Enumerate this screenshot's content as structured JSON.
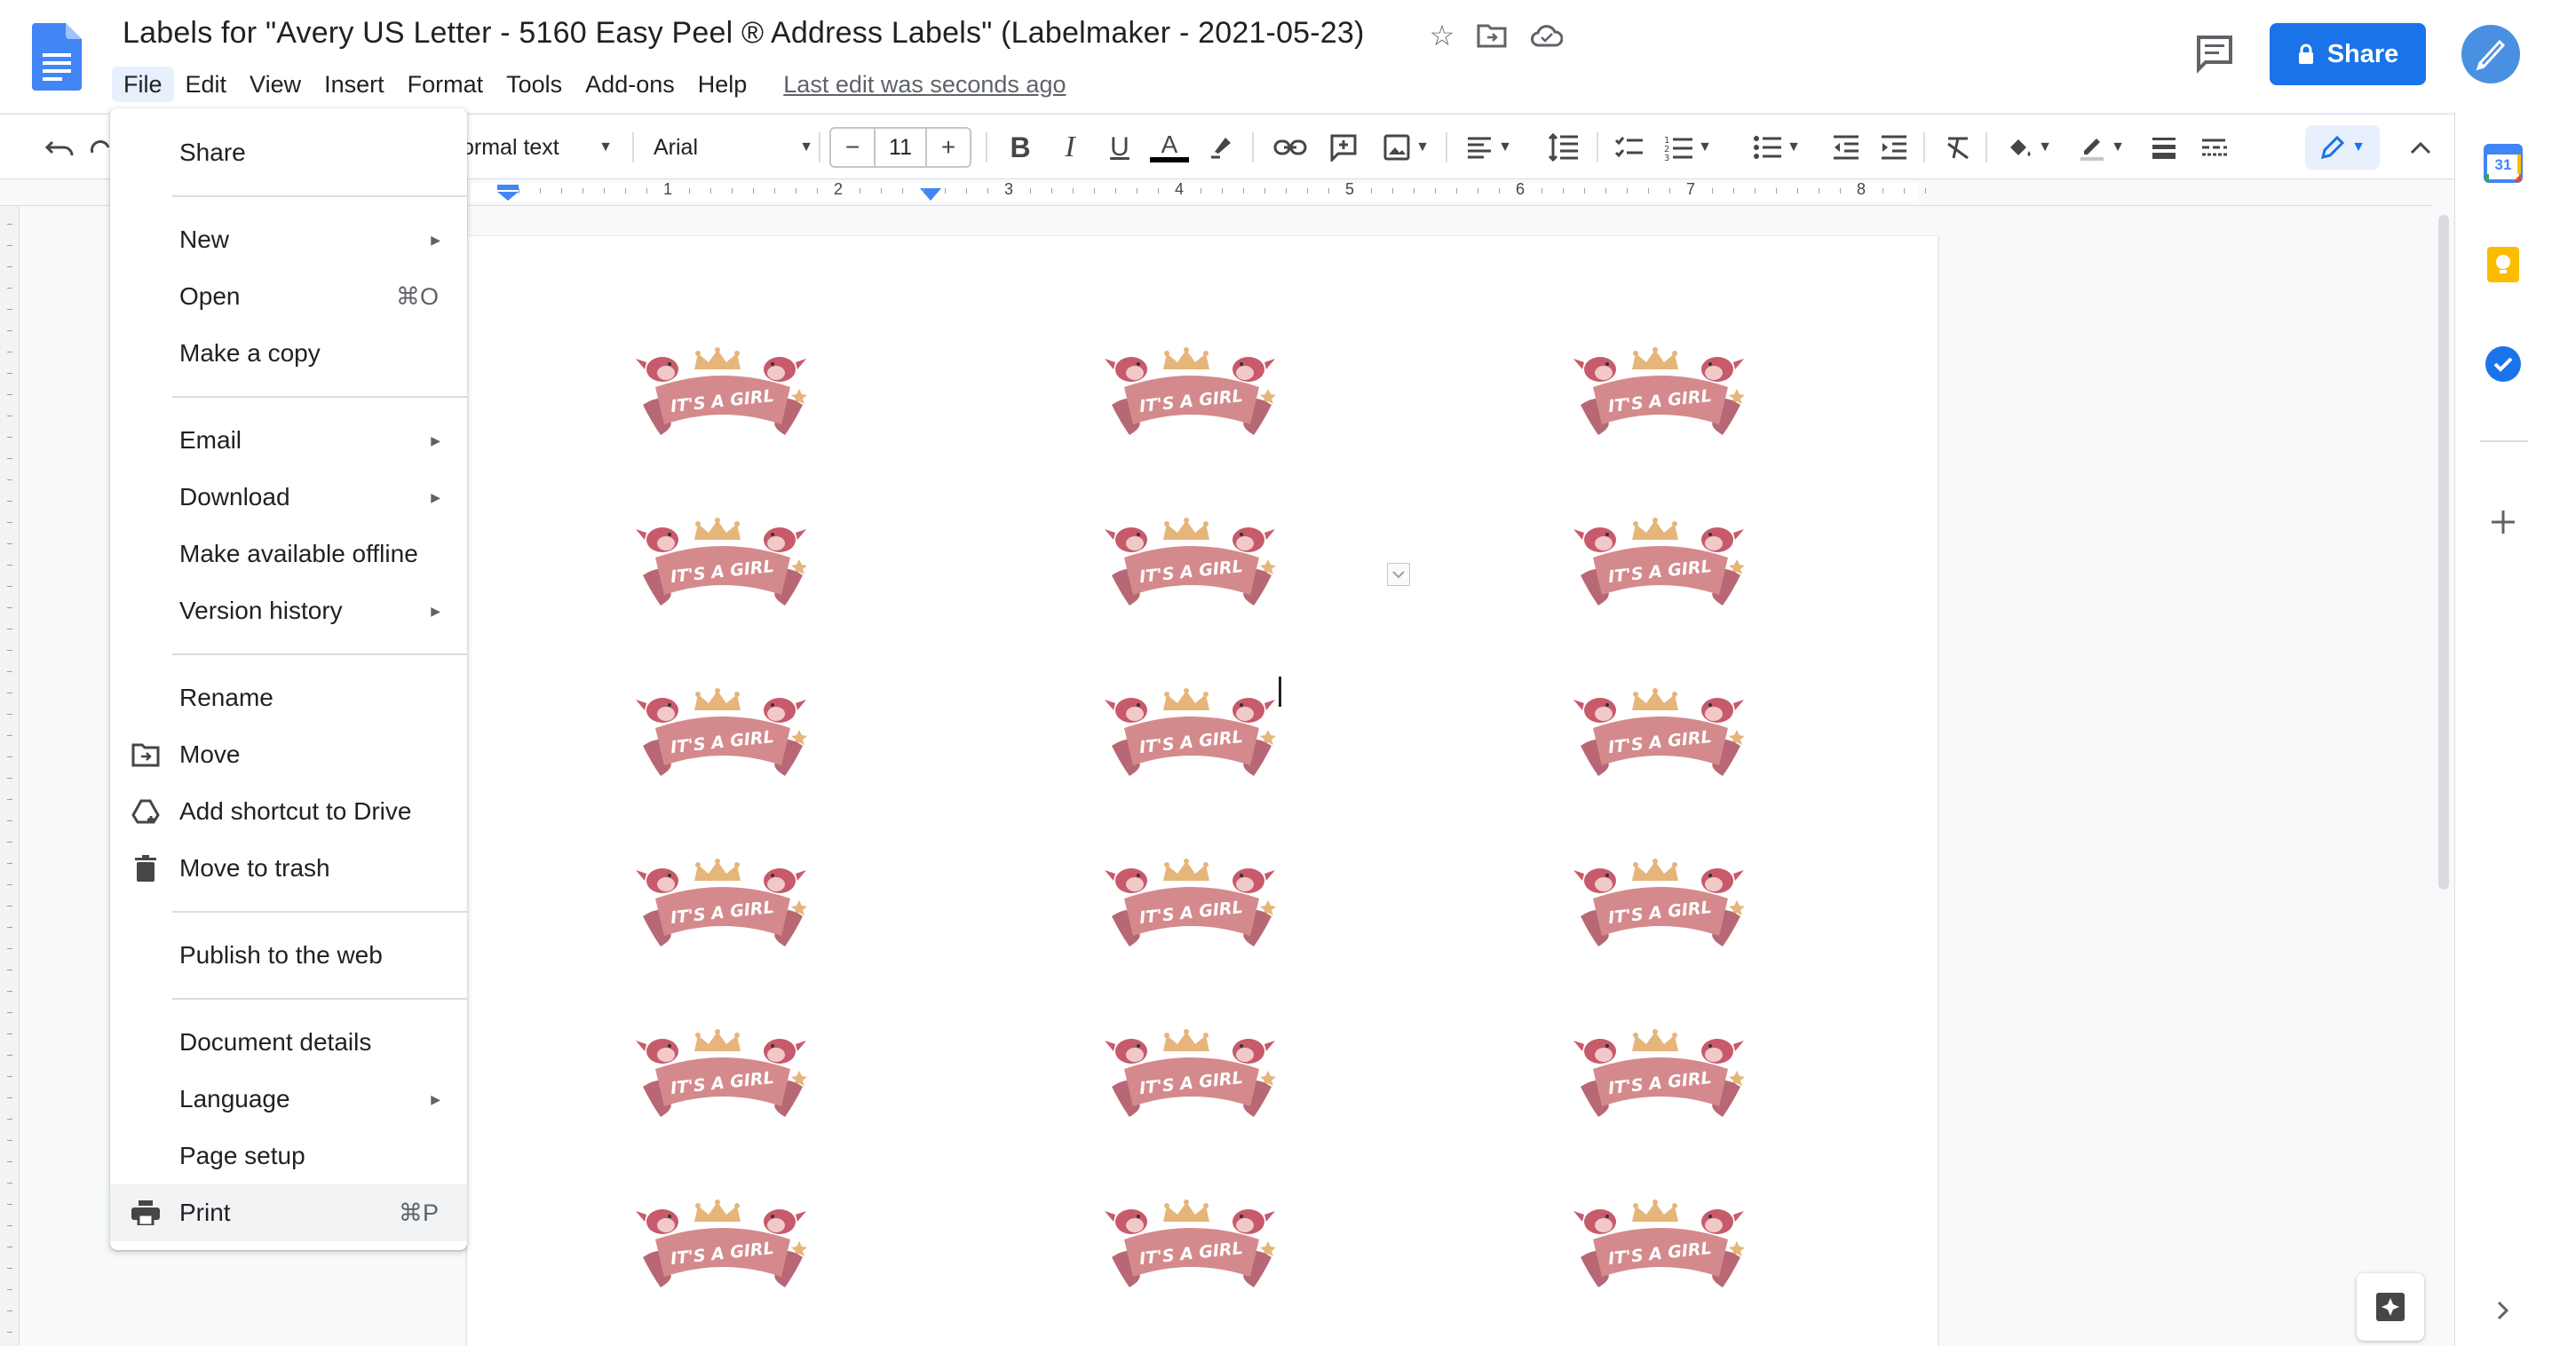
{
  "title_bar": {
    "document_title": "Labels for \"Avery US Letter - 5160 Easy Peel ® Address Labels\" (Labelmaker - 2021-05-23)",
    "last_edit": "Last edit was seconds ago",
    "share_label": "Share"
  },
  "menubar": {
    "file": "File",
    "edit": "Edit",
    "view": "View",
    "insert": "Insert",
    "format": "Format",
    "tools": "Tools",
    "addons": "Add-ons",
    "help": "Help"
  },
  "toolbar": {
    "paragraph_style": "ormal text",
    "font": "Arial",
    "font_size": "11",
    "minus": "−",
    "plus": "+"
  },
  "ruler": {
    "numbers": [
      "1",
      "2",
      "3",
      "4",
      "5",
      "6",
      "7",
      "8"
    ]
  },
  "file_menu": {
    "share": "Share",
    "new": "New",
    "open": "Open",
    "open_shortcut": "⌘O",
    "make_copy": "Make a copy",
    "email": "Email",
    "download": "Download",
    "make_offline": "Make available offline",
    "version_history": "Version history",
    "rename": "Rename",
    "move": "Move",
    "add_shortcut": "Add shortcut to Drive",
    "move_to_trash": "Move to trash",
    "publish": "Publish to the web",
    "doc_details": "Document details",
    "language": "Language",
    "page_setup": "Page setup",
    "print": "Print",
    "print_shortcut": "⌘P"
  },
  "document": {
    "label_text": "IT'S A GIRL",
    "grid_rows": 6,
    "grid_cols": 3
  },
  "side_panel": {
    "calendar_day": "31"
  },
  "colors": {
    "accent": "#1a73e8",
    "label_banner": "#d48a8c",
    "label_crown": "#e6b57a",
    "menu_highlight": "#f1f3f4"
  }
}
